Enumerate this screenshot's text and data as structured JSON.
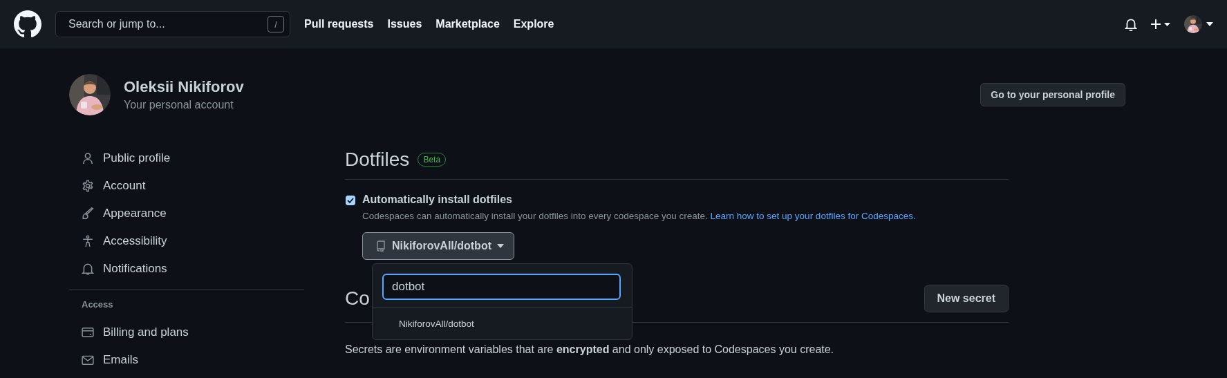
{
  "header": {
    "search": {
      "placeholder": "Search or jump to...",
      "shortcut": "/"
    },
    "nav": [
      "Pull requests",
      "Issues",
      "Marketplace",
      "Explore"
    ]
  },
  "profile": {
    "name": "Oleksii Nikiforov",
    "subtitle": "Your personal account",
    "button": "Go to your personal profile"
  },
  "sidebar": {
    "groups": [
      {
        "items": [
          {
            "label": "Public profile",
            "kind": "person"
          },
          {
            "label": "Account",
            "kind": "gear"
          },
          {
            "label": "Appearance",
            "kind": "brush"
          },
          {
            "label": "Accessibility",
            "kind": "access"
          },
          {
            "label": "Notifications",
            "kind": "bell"
          }
        ]
      },
      {
        "heading": "Access",
        "items": [
          {
            "label": "Billing and plans",
            "kind": "card"
          },
          {
            "label": "Emails",
            "kind": "mail"
          }
        ]
      }
    ]
  },
  "dotfiles": {
    "title": "Dotfiles",
    "badge": "Beta",
    "option": {
      "label": "Automatically install dotfiles",
      "checked": true,
      "description": "Codespaces can automatically install your dotfiles into every codespace you create. ",
      "link": "Learn how to set up your dotfiles for Codespaces."
    },
    "repo_button": "NikiforovAll/dotbot",
    "dropdown": {
      "expanded": true,
      "value": "dotbot",
      "results": [
        "NikiforovAll/dotbot"
      ]
    }
  },
  "secrets": {
    "title": "Co",
    "button": "New secret",
    "description": "Secrets are environment variables that are **encrypted** and only exposed to Codespaces you create."
  }
}
